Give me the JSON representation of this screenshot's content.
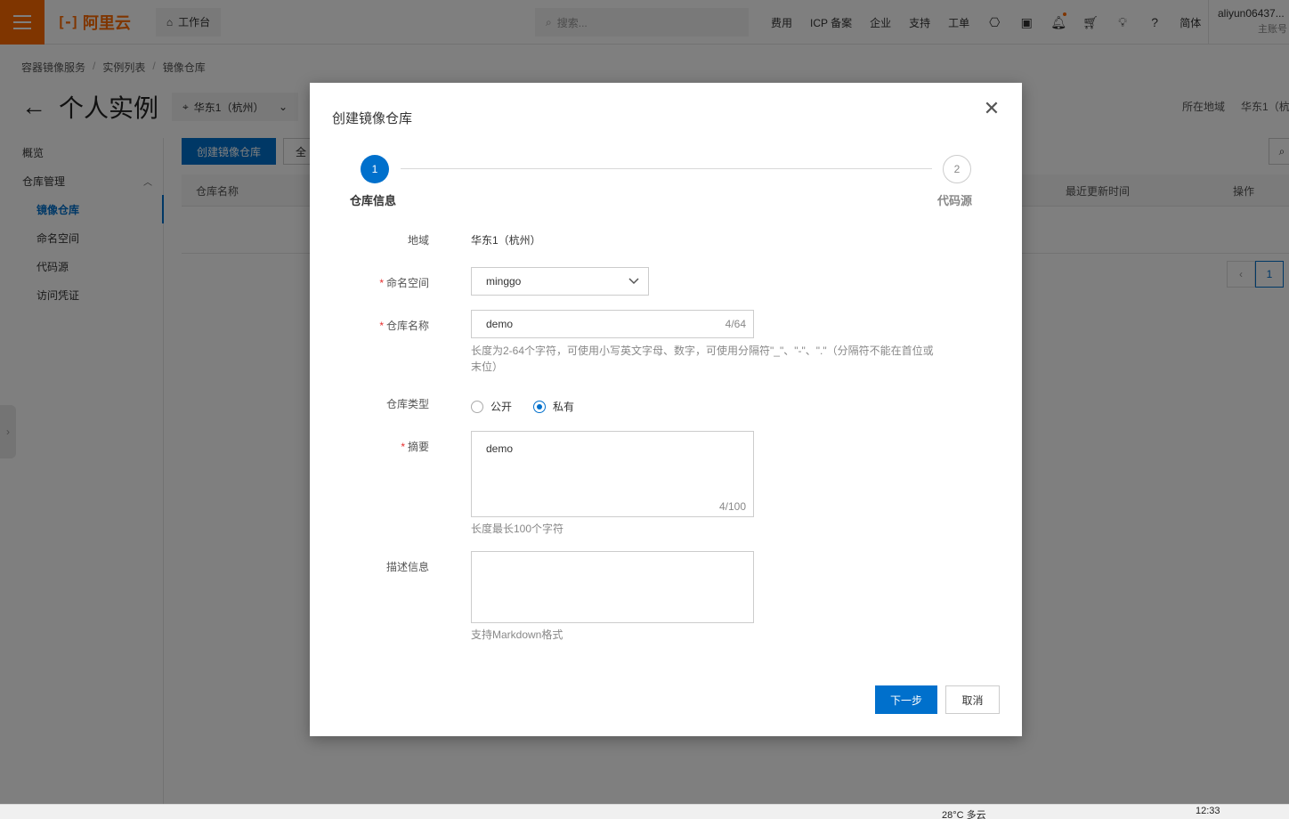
{
  "topbar": {
    "logo_text": "阿里云",
    "workbench_label": "工作台",
    "search_placeholder": "搜索...",
    "links": [
      "费用",
      "ICP 备案",
      "企业",
      "支持",
      "工单"
    ],
    "lang_label": "简体",
    "user_name": "aliyun06437...",
    "user_role": "主账号"
  },
  "breadcrumb": [
    "容器镜像服务",
    "实例列表",
    "镜像仓库"
  ],
  "page": {
    "title": "个人实例",
    "region_select": "华东1（杭州）",
    "region_label": "所在地域",
    "region_value": "华东1（杭"
  },
  "sidebar": {
    "items": [
      {
        "label": "概览"
      },
      {
        "label": "仓库管理"
      },
      {
        "label": "镜像仓库"
      },
      {
        "label": "命名空间"
      },
      {
        "label": "代码源"
      },
      {
        "label": "访问凭证"
      }
    ]
  },
  "main": {
    "create_button": "创建镜像仓库",
    "filter_button": "全",
    "columns": [
      "仓库名称",
      "最近更新时间",
      "操作"
    ],
    "current_page": "1"
  },
  "taskbar": {
    "temp": "28°C 多云",
    "time": "12:33"
  },
  "dialog": {
    "title": "创建镜像仓库",
    "steps": [
      {
        "number": "1",
        "label": "仓库信息"
      },
      {
        "number": "2",
        "label": "代码源"
      }
    ],
    "region_label": "地域",
    "region_value": "华东1（杭州）",
    "namespace_label": "命名空间",
    "namespace_value": "minggo",
    "repo_name_label": "仓库名称",
    "repo_name_value": "demo",
    "repo_name_counter": "4/64",
    "repo_name_help_1": "长度为2-64个字符，可使用小写英文字母、数字，可使用分隔符\"_\"、\"-\"、\".\"（分隔符不能在首位或",
    "repo_name_help_2": "末位）",
    "repo_type_label": "仓库类型",
    "repo_type_options": [
      "公开",
      "私有"
    ],
    "repo_type_selected": "私有",
    "summary_label": "摘要",
    "summary_value": "demo",
    "summary_counter": "4/100",
    "summary_help": "长度最长100个字符",
    "description_label": "描述信息",
    "description_value": "",
    "description_help": "支持Markdown格式",
    "next_button": "下一步",
    "cancel_button": "取消"
  },
  "colors": {
    "brand": "#ff6a00",
    "primary": "#0070cc",
    "required": "#e62e2e"
  }
}
